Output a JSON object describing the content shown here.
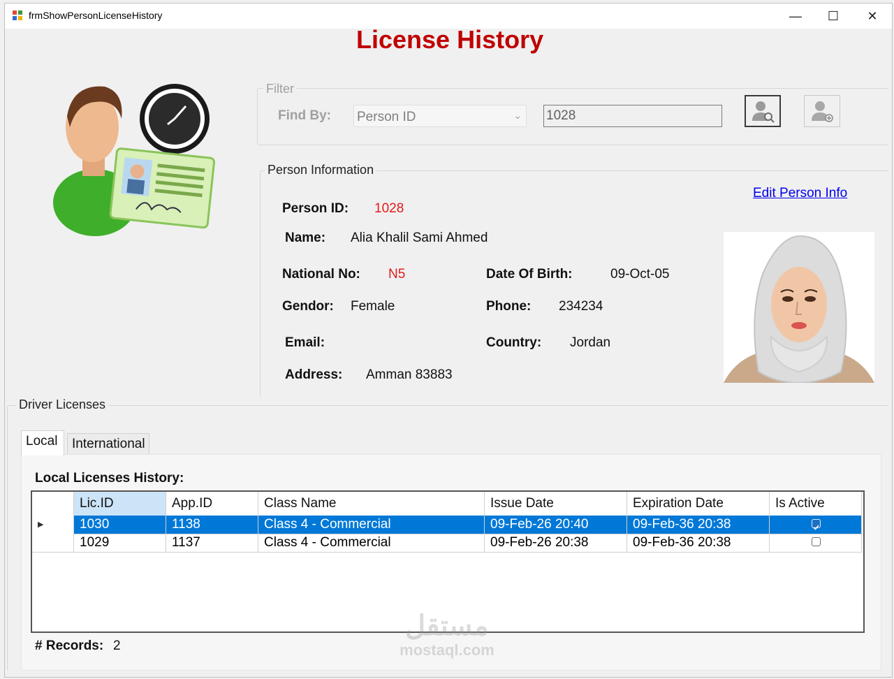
{
  "window": {
    "title": "frmShowPersonLicenseHistory",
    "minimize_glyph": "—",
    "maximize_glyph": "☐",
    "close_glyph": "✕"
  },
  "heading": "License History",
  "filter": {
    "legend": "Filter",
    "find_by_label": "Find By:",
    "find_by_value": "Person ID",
    "search_value": "1028",
    "find_icon": "person-search-icon",
    "add_icon": "person-add-icon"
  },
  "person": {
    "legend": "Person Information",
    "edit_link": "Edit Person Info",
    "person_id_label": "Person ID:",
    "person_id": "1028",
    "name_label": "Name:",
    "name": "Alia Khalil Sami Ahmed",
    "national_no_label": "National No:",
    "national_no": "N5",
    "dob_label": "Date Of Birth:",
    "dob": "09-Oct-05",
    "gender_label": "Gendor:",
    "gender": "Female",
    "phone_label": "Phone:",
    "phone": "234234",
    "email_label": "Email:",
    "email": "",
    "country_label": "Country:",
    "country": "Jordan",
    "address_label": "Address:",
    "address": "Amman 83883"
  },
  "licenses": {
    "legend": "Driver Licenses",
    "tabs": [
      "Local",
      "International"
    ],
    "history_title": "Local Licenses History:",
    "columns": [
      "Lic.ID",
      "App.ID",
      "Class Name",
      "Issue Date",
      "Expiration Date",
      "Is Active"
    ],
    "rows": [
      {
        "lic_id": "1030",
        "app_id": "1138",
        "class_name": "Class 4 - Commercial",
        "issue_date": "09-Feb-26 20:40",
        "expiration_date": "09-Feb-36 20:38",
        "is_active": true
      },
      {
        "lic_id": "1029",
        "app_id": "1137",
        "class_name": "Class 4 - Commercial",
        "issue_date": "09-Feb-26 20:38",
        "expiration_date": "09-Feb-36 20:38",
        "is_active": false
      }
    ],
    "records_label": "# Records:",
    "records_count": "2"
  },
  "watermark": {
    "arabic": "مستقل",
    "latin": "mostaql.com"
  },
  "colors": {
    "heading_red": "#c00000",
    "value_red": "#e11b1b",
    "selection_blue": "#0078d7",
    "link_blue": "#0000ee"
  }
}
